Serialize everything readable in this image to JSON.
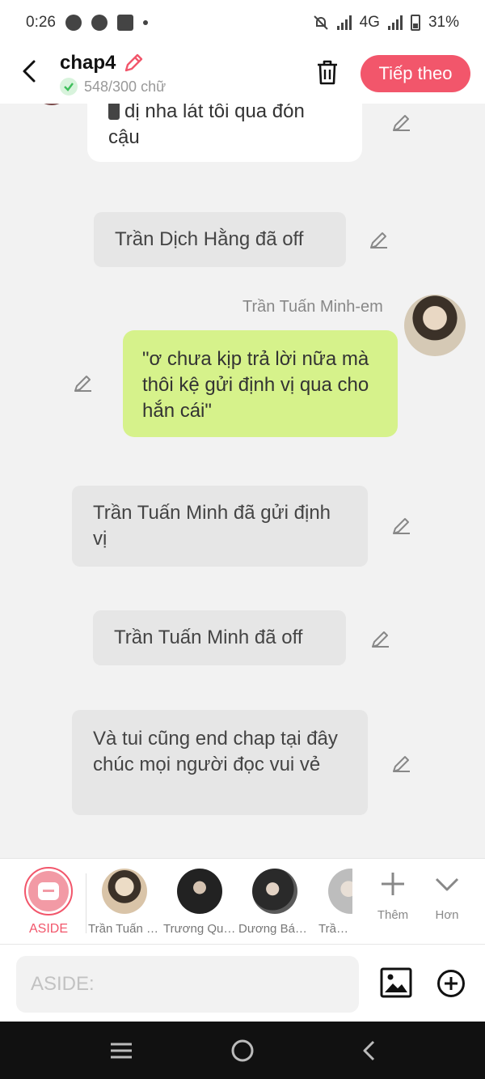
{
  "status": {
    "time": "0:26",
    "network": "4G",
    "battery": "31%"
  },
  "header": {
    "title": "chap4",
    "word_count": "548/300 chữ",
    "next_label": "Tiếp theo"
  },
  "messages": {
    "top_line1": "dị nha lát tôi qua đón",
    "top_line2": "cậu",
    "sys1": "Trần Dịch Hằng đã off",
    "author": "Trần Tuấn Minh-em",
    "green": "\"ơ chưa kịp trả lời nữa mà thôi kệ gửi định vị qua cho hắn cái\"",
    "sys2": "Trần Tuấn Minh đã gửi định vị",
    "sys3": "Trần Tuấn Minh đã off",
    "sys4": "Và tui cũng end chap tại đây chúc mọi người đọc vui vẻ"
  },
  "characters": {
    "aside_label": "ASIDE",
    "items": [
      {
        "name": "Trần Tuấn Minh-em",
        "color": "#d9c4a8"
      },
      {
        "name": "Trương Quỳnh",
        "color": "#222222"
      },
      {
        "name": "Dương Bác Văn",
        "color": "#2a2a2a"
      },
      {
        "name": "Trần Dịch Hằng",
        "color": "#cfcfcf"
      }
    ],
    "add_label": "Thêm",
    "more_label": "Hơn"
  },
  "input": {
    "placeholder": "ASIDE:"
  },
  "colors": {
    "accent": "#f2566b",
    "green_bubble": "#d6f28b",
    "system_bubble": "#e6e6e6"
  }
}
